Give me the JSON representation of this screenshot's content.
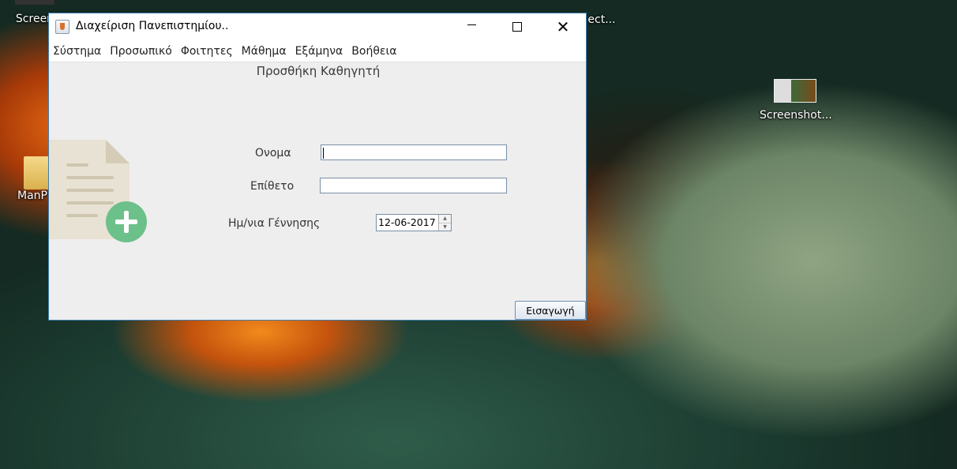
{
  "desktop": {
    "icons": [
      {
        "label": "Screen"
      },
      {
        "label": "ManP"
      },
      {
        "label": "ect..."
      },
      {
        "label": "Screenshot..."
      }
    ]
  },
  "window": {
    "title": "Διαχείριση Πανεπιστημίου..",
    "close_symbol": "✕"
  },
  "menubar": {
    "items": [
      "Σύστημα",
      "Προσωπικό",
      "Φοιτητες",
      "Μάθημα",
      "Εξάμηνα",
      "Βοήθεια"
    ]
  },
  "form": {
    "title": "Προσθήκη Καθηγητή",
    "first_name_label": "Ονομα",
    "first_name_value": "",
    "last_name_label": "Επίθετο",
    "last_name_value": "",
    "birthdate_label": "Ημ/νια Γέννησης",
    "birthdate_value": "12-06-2017",
    "spin_up": "▲",
    "spin_down": "▼",
    "submit_label": "Εισαγωγή"
  },
  "colors": {
    "window_border": "#3c7fb1",
    "add_badge": "#6cc08a"
  },
  "icons": {
    "doc": "add-document-icon",
    "app": "java-app-icon"
  }
}
